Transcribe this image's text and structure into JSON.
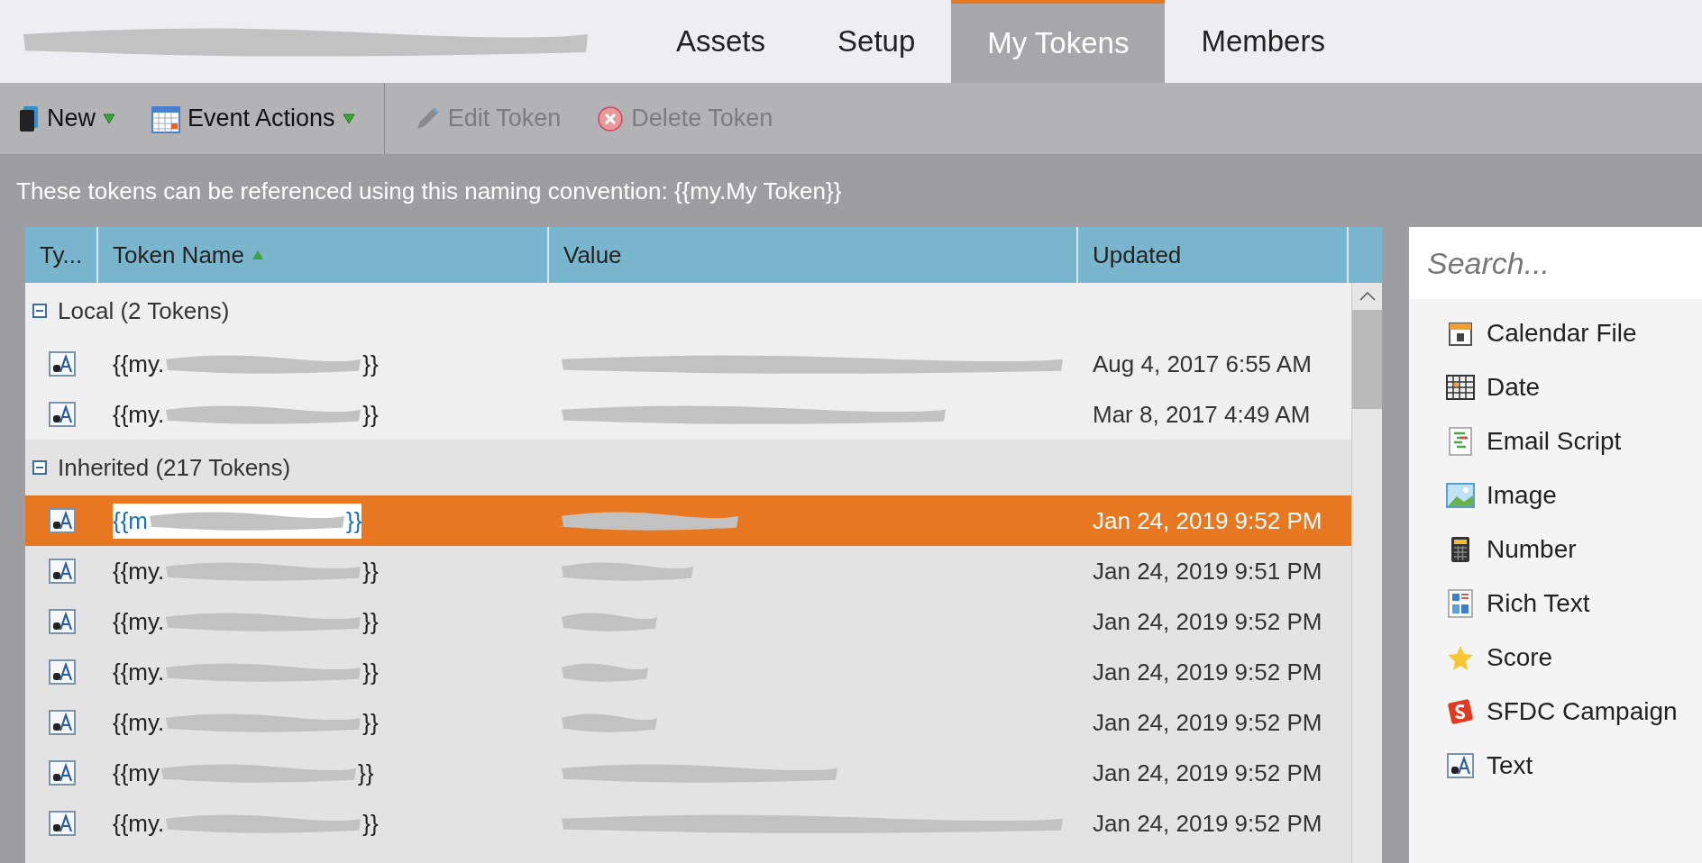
{
  "tabs": [
    {
      "label": "Assets",
      "selected": false
    },
    {
      "label": "Setup",
      "selected": false
    },
    {
      "label": "My Tokens",
      "selected": true
    },
    {
      "label": "Members",
      "selected": false
    }
  ],
  "toolbar": [
    {
      "label": "New",
      "kind": "new",
      "disabled": false,
      "dropdown": true
    },
    {
      "label": "Event Actions",
      "kind": "calendar",
      "disabled": false,
      "dropdown": true
    },
    {
      "label": "Edit Token",
      "kind": "edit",
      "disabled": true,
      "dropdown": false
    },
    {
      "label": "Delete Token",
      "kind": "delete",
      "disabled": true,
      "dropdown": false
    }
  ],
  "info": "These tokens can be referenced using this naming convention: {{my.My Token}}",
  "table": {
    "columns": [
      "Ty...",
      "Token Name",
      "Value",
      "Updated"
    ],
    "groups": [
      {
        "label": "Local (2 Tokens)",
        "expanded": true,
        "rows": [
          {
            "name_start": "{{my.",
            "name_end": "}}",
            "updated": "Aug 4, 2017 6:55 AM",
            "selected": false
          },
          {
            "name_start": "{{my.",
            "name_end": "}}",
            "updated": "Mar 8, 2017 4:49 AM",
            "selected": false
          }
        ]
      },
      {
        "label": "Inherited (217 Tokens)",
        "expanded": true,
        "rows": [
          {
            "name_start": "{{m",
            "name_end": "}}",
            "updated": "Jan 24, 2019 9:52 PM",
            "selected": true
          },
          {
            "name_start": "{{my.",
            "name_end": "}}",
            "updated": "Jan 24, 2019 9:51 PM",
            "selected": false
          },
          {
            "name_start": "{{my.",
            "name_end": "}}",
            "updated": "Jan 24, 2019 9:52 PM",
            "selected": false
          },
          {
            "name_start": "{{my.",
            "name_end": "}}",
            "updated": "Jan 24, 2019 9:52 PM",
            "selected": false
          },
          {
            "name_start": "{{my.",
            "name_end": "}}",
            "updated": "Jan 24, 2019 9:52 PM",
            "selected": false
          },
          {
            "name_start": "{{my",
            "name_end": "}}",
            "updated": "Jan 24, 2019 9:52 PM",
            "selected": false
          },
          {
            "name_start": "{{my.",
            "name_end": "}}",
            "updated": "Jan 24, 2019 9:52 PM",
            "selected": false
          }
        ]
      }
    ]
  },
  "palette": {
    "search": {
      "placeholder": "Search..."
    },
    "items": [
      {
        "label": "Calendar File",
        "kind": "calendar-file"
      },
      {
        "label": "Date",
        "kind": "date"
      },
      {
        "label": "Email Script",
        "kind": "script"
      },
      {
        "label": "Image",
        "kind": "image"
      },
      {
        "label": "Number",
        "kind": "number"
      },
      {
        "label": "Rich Text",
        "kind": "rich-text"
      },
      {
        "label": "Score",
        "kind": "score"
      },
      {
        "label": "SFDC Campaign",
        "kind": "sfdc"
      },
      {
        "label": "Text",
        "kind": "text"
      }
    ]
  }
}
